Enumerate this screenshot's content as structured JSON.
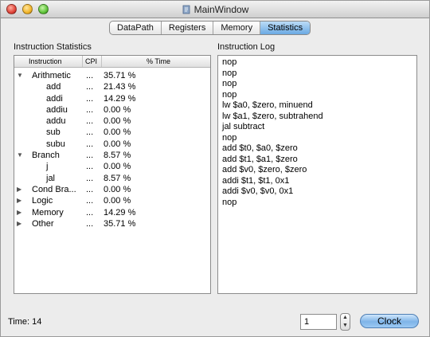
{
  "window": {
    "title": "MainWindow",
    "title_icon": "app-icon"
  },
  "tabs": [
    {
      "label": "DataPath",
      "active": false
    },
    {
      "label": "Registers",
      "active": false
    },
    {
      "label": "Memory",
      "active": false
    },
    {
      "label": "Statistics",
      "active": true
    }
  ],
  "stats": {
    "title": "Instruction Statistics",
    "columns": [
      "Instruction",
      "CPI",
      "% Time"
    ],
    "rows": [
      {
        "name": "Arithmetic",
        "cpi": "...",
        "pct": "35.71 %",
        "expanded": true,
        "child": false
      },
      {
        "name": "add",
        "cpi": "...",
        "pct": "21.43 %",
        "child": true
      },
      {
        "name": "addi",
        "cpi": "...",
        "pct": "14.29 %",
        "child": true
      },
      {
        "name": "addiu",
        "cpi": "...",
        "pct": "0.00 %",
        "child": true
      },
      {
        "name": "addu",
        "cpi": "...",
        "pct": "0.00 %",
        "child": true
      },
      {
        "name": "sub",
        "cpi": "...",
        "pct": "0.00 %",
        "child": true
      },
      {
        "name": "subu",
        "cpi": "...",
        "pct": "0.00 %",
        "child": true
      },
      {
        "name": "Branch",
        "cpi": "...",
        "pct": "8.57 %",
        "expanded": true,
        "child": false
      },
      {
        "name": "j",
        "cpi": "...",
        "pct": "0.00 %",
        "child": true
      },
      {
        "name": "jal",
        "cpi": "...",
        "pct": "8.57 %",
        "child": true
      },
      {
        "name": "Cond Bra...",
        "cpi": "...",
        "pct": "0.00 %",
        "expanded": false,
        "child": false
      },
      {
        "name": "Logic",
        "cpi": "...",
        "pct": "0.00 %",
        "expanded": false,
        "child": false
      },
      {
        "name": "Memory",
        "cpi": "...",
        "pct": "14.29 %",
        "expanded": false,
        "child": false
      },
      {
        "name": "Other",
        "cpi": "...",
        "pct": "35.71 %",
        "expanded": false,
        "child": false
      }
    ]
  },
  "log": {
    "title": "Instruction Log",
    "lines": [
      "nop",
      "nop",
      "nop",
      "nop",
      "lw $a0, $zero, minuend",
      "lw $a1, $zero, subtrahend",
      "jal subtract",
      "nop",
      "add $t0, $a0, $zero",
      "add $t1, $a1, $zero",
      "add $v0, $zero, $zero",
      "addi $t1, $t1, 0x1",
      "addi $v0, $v0, 0x1",
      "nop"
    ]
  },
  "footer": {
    "time_label": "Time: 14",
    "step_value": "1",
    "clock_label": "Clock"
  }
}
